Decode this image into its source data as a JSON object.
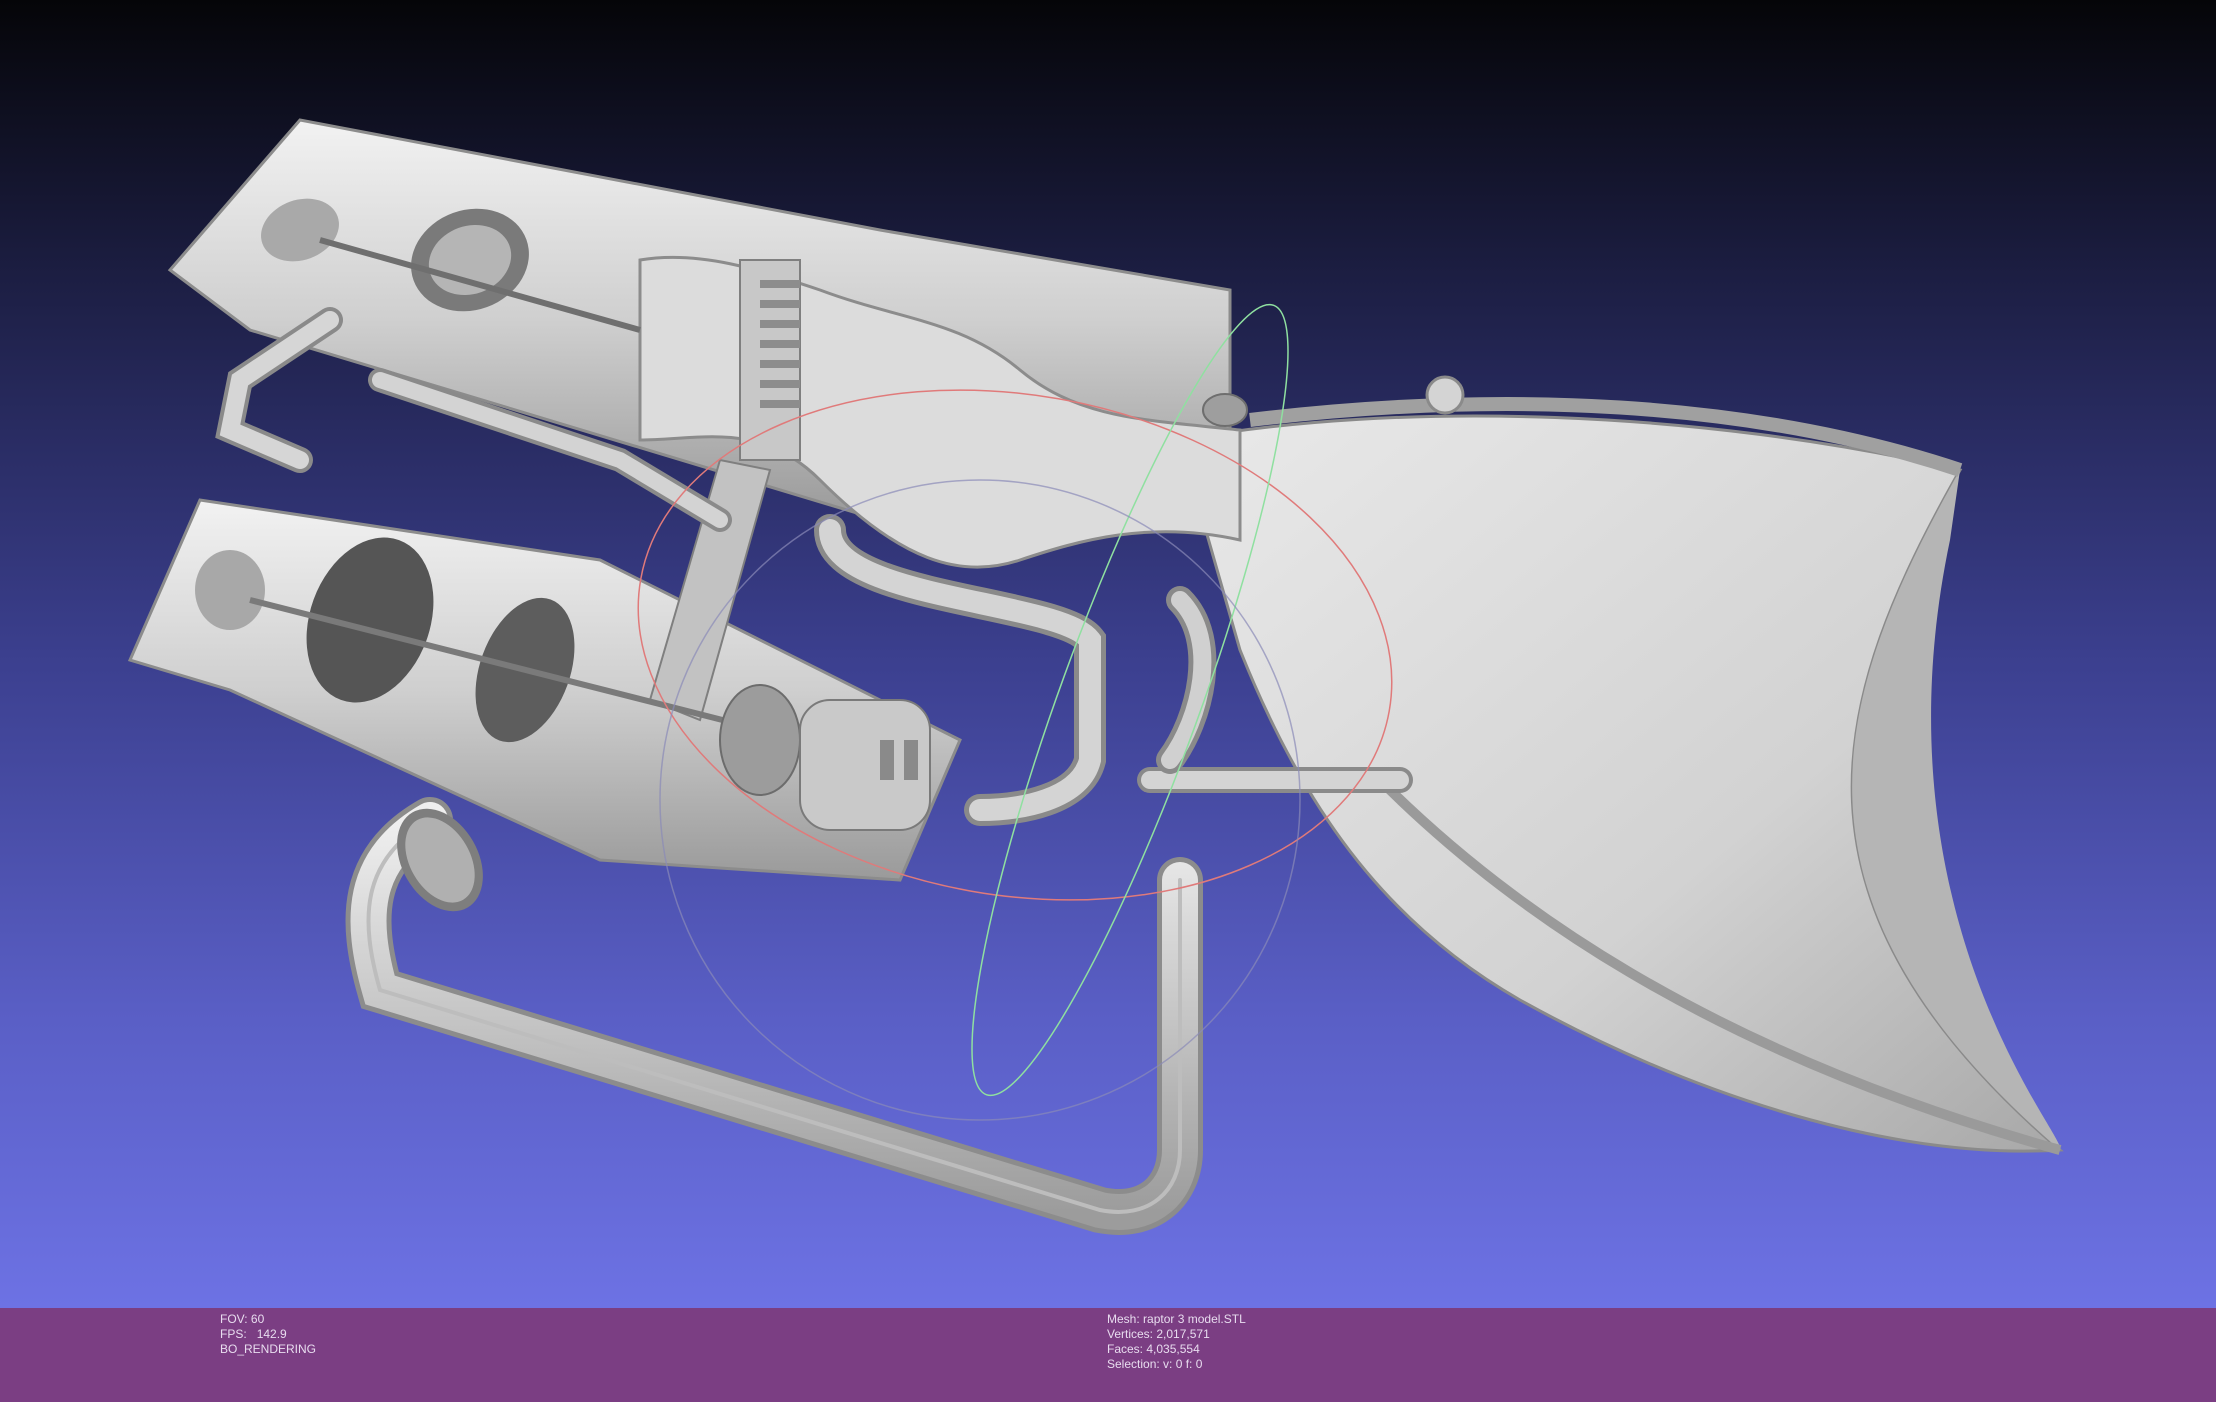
{
  "viewer": {
    "canvas_name": "3d-viewport",
    "background_top": "#050508",
    "background_bottom": "#6d72e4",
    "model_color": "#d6d6d6",
    "trackball_colors": {
      "x_ring": "#e07a7a",
      "y_ring": "#8fe0a0",
      "z_ring": "#8a8ab8"
    }
  },
  "status_bar": {
    "color": "#7b3e83",
    "left": {
      "fov_label": "FOV:",
      "fov_value": "60",
      "fps_label": "FPS:",
      "fps_value": "142.9",
      "render_mode": "BO_RENDERING"
    },
    "right": {
      "mesh_label": "Mesh:",
      "mesh_value": "raptor 3 model.STL",
      "vertices_label": "Vertices:",
      "vertices_value": "2,017,571",
      "faces_label": "Faces:",
      "faces_value": "4,035,554",
      "selection_label": "Selection:",
      "selection_value": "v: 0 f: 0"
    }
  }
}
